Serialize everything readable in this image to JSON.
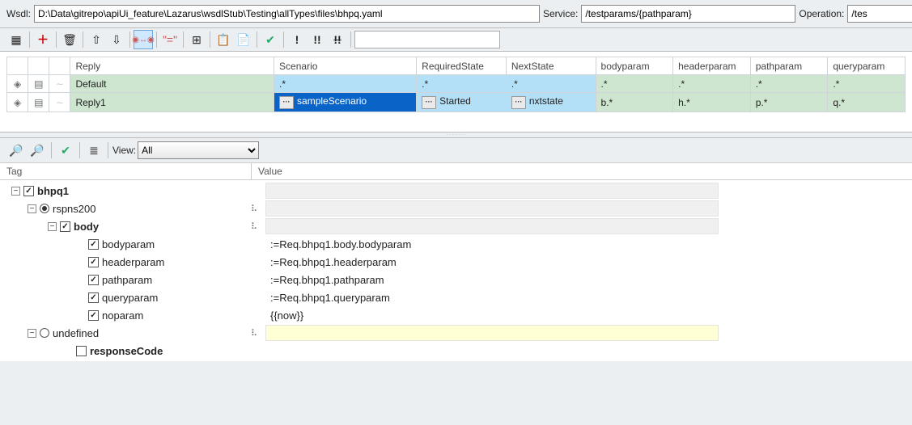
{
  "header": {
    "wsdl_label": "Wsdl:",
    "wsdl_value": "D:\\Data\\gitrepo\\apiUi_feature\\Lazarus\\wsdlStub\\Testing\\allTypes\\files\\bhpq.yaml",
    "service_label": "Service:",
    "service_value": "/testparams/{pathparam}",
    "operation_label": "Operation:",
    "operation_value": "/tes"
  },
  "grid": {
    "columns": [
      "",
      "",
      "",
      "Reply",
      "Scenario",
      "RequiredState",
      "NextState",
      "bodyparam",
      "headerparam",
      "pathparam",
      "queryparam"
    ],
    "rows": [
      {
        "reply": "Default",
        "scenario": ".*",
        "required": ".*",
        "next": ".*",
        "body": ".*",
        "header": ".*",
        "path": ".*",
        "query": ".*",
        "style": "default"
      },
      {
        "reply": "Reply1",
        "scenario": "sampleScenario",
        "required": "Started",
        "next": "nxtstate",
        "body": "b.*",
        "header": "h.*",
        "path": "p.*",
        "query": "q.*",
        "style": "selected"
      }
    ]
  },
  "bottom": {
    "view_label": "View:",
    "view_value": "All",
    "tag_label": "Tag",
    "value_label": "Value"
  },
  "tree": [
    {
      "indent": 10,
      "toggle": "-",
      "check": true,
      "radio": "",
      "label": "bhpq1",
      "bold": true,
      "value": "",
      "valstyle": "empty",
      "hasicon": false
    },
    {
      "indent": 30,
      "toggle": "-",
      "check": "",
      "radio": "sel",
      "label": "rspns200",
      "bold": false,
      "value": "",
      "valstyle": "empty",
      "hasicon": true
    },
    {
      "indent": 55,
      "toggle": "-",
      "check": true,
      "radio": "",
      "label": "body",
      "bold": true,
      "value": "",
      "valstyle": "empty",
      "hasicon": true
    },
    {
      "indent": 90,
      "toggle": "",
      "check": true,
      "radio": "",
      "label": "bodyparam",
      "bold": false,
      "value": ":=Req.bhpq1.body.bodyparam",
      "valstyle": "",
      "hasicon": false
    },
    {
      "indent": 90,
      "toggle": "",
      "check": true,
      "radio": "",
      "label": "headerparam",
      "bold": false,
      "value": ":=Req.bhpq1.headerparam",
      "valstyle": "",
      "hasicon": false
    },
    {
      "indent": 90,
      "toggle": "",
      "check": true,
      "radio": "",
      "label": "pathparam",
      "bold": false,
      "value": ":=Req.bhpq1.pathparam",
      "valstyle": "",
      "hasicon": false
    },
    {
      "indent": 90,
      "toggle": "",
      "check": true,
      "radio": "",
      "label": "queryparam",
      "bold": false,
      "value": ":=Req.bhpq1.queryparam",
      "valstyle": "",
      "hasicon": false
    },
    {
      "indent": 90,
      "toggle": "",
      "check": true,
      "radio": "",
      "label": "noparam",
      "bold": false,
      "value": "{{now}}",
      "valstyle": "",
      "hasicon": false
    },
    {
      "indent": 30,
      "toggle": "-",
      "check": "",
      "radio": "unsel",
      "label": "undefined",
      "bold": false,
      "value": "",
      "valstyle": "yellow",
      "hasicon": true
    },
    {
      "indent": 75,
      "toggle": "",
      "check": false,
      "radio": "",
      "label": "responseCode",
      "bold": true,
      "value": "",
      "valstyle": "",
      "hasicon": false
    }
  ]
}
